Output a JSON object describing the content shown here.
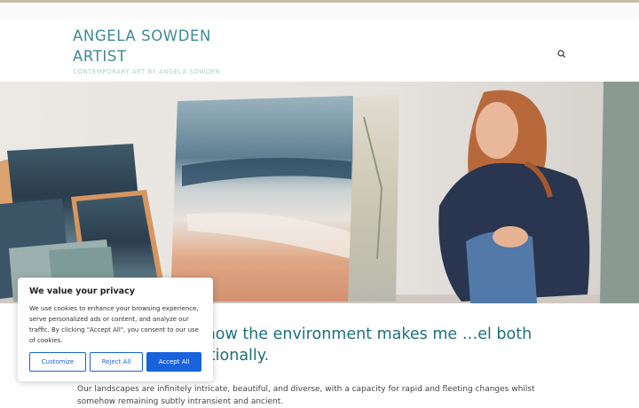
{
  "header": {
    "site_title": "ANGELA SOWDEN ARTIST",
    "tagline": "CONTEMPORARY ART BY ANGELA SOWDEN",
    "search_icon": "search-icon"
  },
  "hero": {
    "image": "artist-with-paintings-photo"
  },
  "main": {
    "headline": "…me to explore how the environment makes me …el both visually and emotionally.",
    "paragraph": "Our landscapes are infinitely intricate, beautiful, and diverse, with a capacity for rapid and fleeting changes whilst somehow remaining subtly intransient and ancient."
  },
  "cookie_banner": {
    "title": "We value your privacy",
    "text": "We use cookies to enhance your browsing experience, serve personalized ads or content, and analyze our traffic. By clicking \"Accept All\", you consent to our use of cookies.",
    "customize_label": "Customize",
    "reject_label": "Reject All",
    "accept_label": "Accept All"
  },
  "colors": {
    "title": "#3d8a93",
    "headline": "#1f6f79",
    "cookie_accent": "#1863dc"
  }
}
